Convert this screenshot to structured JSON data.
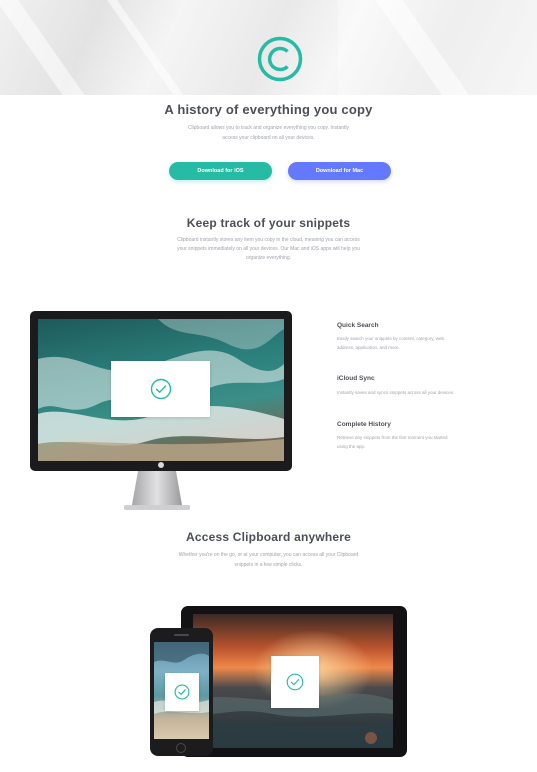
{
  "hero": {
    "logo_icon": "clipboard-logo-icon",
    "title": "A history of everything you copy",
    "subtitle_line1": "Clipboard allows you to track and organize everything you copy. Instantly",
    "subtitle_line2": "access your clipboard on all your devices.",
    "ios_button": "Download for iOS",
    "mac_button": "Download for Mac"
  },
  "snippets": {
    "title": "Keep track of your snippets",
    "line1": "Clipboard instantly stores any item you copy in the cloud, meaning you can access",
    "line2": "your snippets immediately on all your devices. Our Mac and iOS apps will help you",
    "line3": "organize everything."
  },
  "features": [
    {
      "title": "Quick Search",
      "line1": "Easily search your snippets by content, category, web",
      "line2": "address, application, and more."
    },
    {
      "title": "iCloud Sync",
      "line1": "Instantly saves and syncs snippets across all your devices.",
      "line2": ""
    },
    {
      "title": "Complete History",
      "line1": "Retrieve any snippets from the first moment you started",
      "line2": "using the app."
    }
  ],
  "access": {
    "title": "Access Clipboard anywhere",
    "line1": "Whether you're on the go, or at your computer, you can access all your Clipboard",
    "line2": "snippets in a few simple clicks."
  },
  "colors": {
    "teal": "#26bba4",
    "blue": "#6479ff",
    "heading": "#4c4f58",
    "body": "#a1a4ab"
  }
}
